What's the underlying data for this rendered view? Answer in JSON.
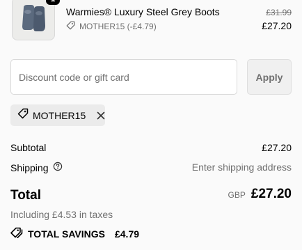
{
  "product": {
    "image": "grey-boots-thumbnail",
    "quantity": "1",
    "title": "Warmies® Luxury Steel Grey Boots",
    "discount_code": "MOTHER15 (-£4.79)",
    "original_price": "£31.99",
    "price": "£27.20"
  },
  "discount": {
    "placeholder": "Discount code or gift card",
    "value": "",
    "apply_label": "Apply",
    "applied_code": "MOTHER15"
  },
  "summary": {
    "subtotal_label": "Subtotal",
    "subtotal_value": "£27.20",
    "shipping_label": "Shipping",
    "shipping_value": "Enter shipping address",
    "total_label": "Total",
    "currency": "GBP",
    "total_value": "£27.20",
    "taxes_note": "Including £4.53 in taxes",
    "savings_label": "TOTAL SAVINGS",
    "savings_value": "£4.79"
  },
  "icons": {
    "tag": "tag-icon",
    "close": "close-icon",
    "help": "help-circle-icon",
    "savings": "tag-stack-icon"
  },
  "colors": {
    "text_primary": "#000000",
    "text_secondary": "#707070",
    "border": "#d9d9d9",
    "chip_bg": "#ebebeb",
    "page_bg": "#fafafa"
  }
}
